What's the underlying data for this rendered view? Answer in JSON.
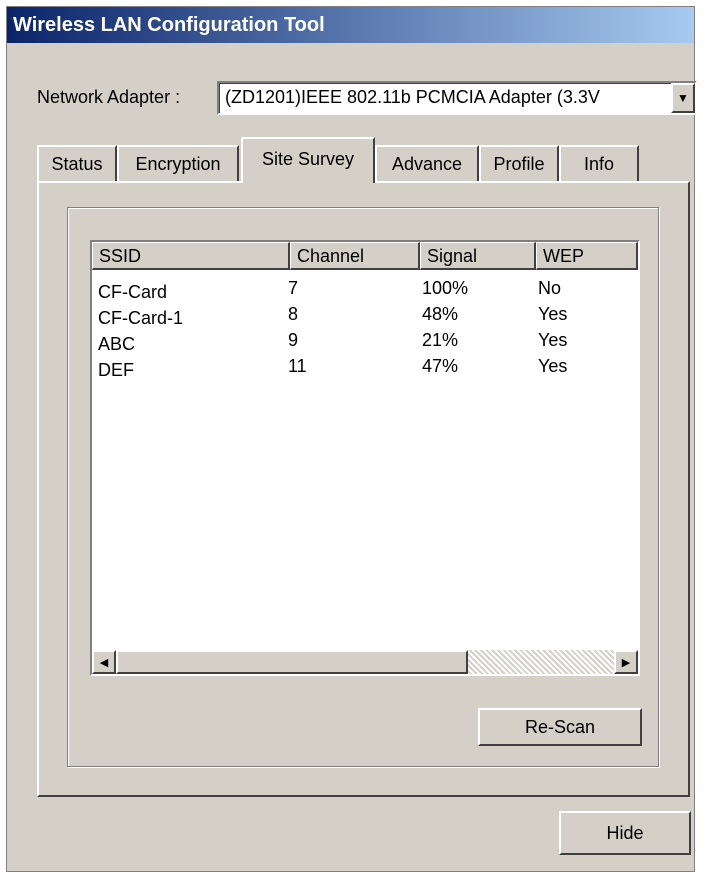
{
  "window": {
    "title": "Wireless LAN Configuration Tool"
  },
  "adapter": {
    "label": "Network Adapter :",
    "value": "(ZD1201)IEEE 802.11b PCMCIA Adapter (3.3V"
  },
  "tabs": [
    {
      "label": "Status",
      "active": false
    },
    {
      "label": "Encryption",
      "active": false
    },
    {
      "label": "Site Survey",
      "active": true
    },
    {
      "label": "Advance",
      "active": false
    },
    {
      "label": "Profile",
      "active": false
    },
    {
      "label": "Info",
      "active": false
    }
  ],
  "list": {
    "columns": [
      "SSID",
      "Channel",
      "Signal",
      "WEP"
    ],
    "rows": [
      [
        "CF-Card",
        "7",
        "100%",
        "No"
      ],
      [
        "CF-Card-1",
        "8",
        "48%",
        "Yes"
      ],
      [
        "ABC",
        "9",
        "21%",
        "Yes"
      ],
      [
        "DEF",
        "11",
        "47%",
        "Yes"
      ]
    ]
  },
  "buttons": {
    "rescan": "Re-Scan",
    "hide": "Hide"
  },
  "icons": {
    "dropdown": "chevron-down-icon",
    "scroll_left": "arrow-left-icon",
    "scroll_right": "arrow-right-icon"
  },
  "colors": {
    "title_start": "#0a246a",
    "title_end": "#a6caf0",
    "face": "#d4d0c8"
  }
}
